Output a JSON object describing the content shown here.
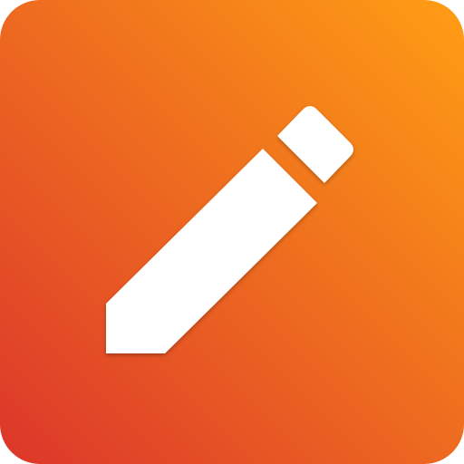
{
  "icon": {
    "name": "edit-pencil-icon",
    "gradient_start_color": "#FF9E14",
    "gradient_end_color": "#DC362B",
    "glyph_color": "#FFFFFF"
  }
}
